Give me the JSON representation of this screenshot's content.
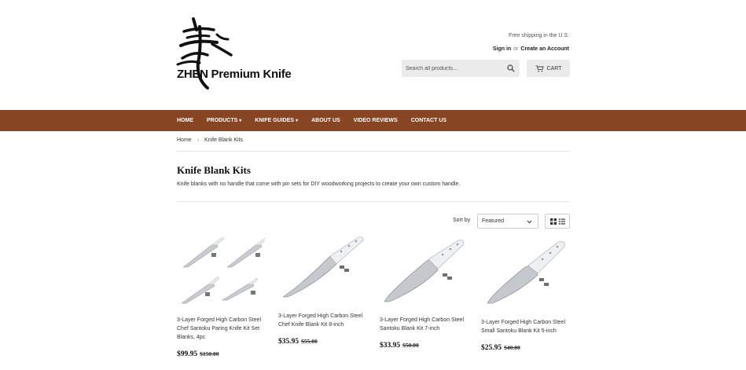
{
  "header": {
    "logo_text": "ZHEN Premium Knife",
    "shipping_note": "Free shipping in the U.S.",
    "sign_in": "Sign in",
    "or": "or",
    "create_account": "Create an Account",
    "search_placeholder": "Search all products...",
    "cart_label": "CART"
  },
  "nav": {
    "items": [
      {
        "label": "HOME",
        "dropdown": false
      },
      {
        "label": "PRODUCTS",
        "dropdown": true
      },
      {
        "label": "KNIFE GUIDES",
        "dropdown": true
      },
      {
        "label": "ABOUT US",
        "dropdown": false
      },
      {
        "label": "VIDEO REVIEWS",
        "dropdown": false
      },
      {
        "label": "CONTACT US",
        "dropdown": false
      }
    ],
    "caret": "▾",
    "color": "#884524"
  },
  "breadcrumb": {
    "home": "Home",
    "sep": "›",
    "current": "Knife Blank Kits"
  },
  "collection": {
    "title": "Knife Blank Kits",
    "description": "Knife blanks with no handle that come with pin sets for DIY woodworking projects to create your own custom handle."
  },
  "sort": {
    "label": "Sort by",
    "selected": "Featured"
  },
  "products": [
    {
      "name": "3-Layer Forged High Carbon Steel Chef Santoku Paring Knife Kit Set Blanks, 4pc",
      "price": "$99.95",
      "compare_at": "$150.00"
    },
    {
      "name": "3-Layer Forged High Carbon Steel Chef Knife Blank Kit 8-inch",
      "price": "$35.95",
      "compare_at": "$55.00"
    },
    {
      "name": "3-Layer Forged High Carbon Steel Santoku Blank Kit 7-inch",
      "price": "$33.95",
      "compare_at": "$50.00"
    },
    {
      "name": "3-Layer Forged High Carbon Steel Small Santoku Blank Kit 5-inch",
      "price": "$25.95",
      "compare_at": "$40.00"
    }
  ]
}
